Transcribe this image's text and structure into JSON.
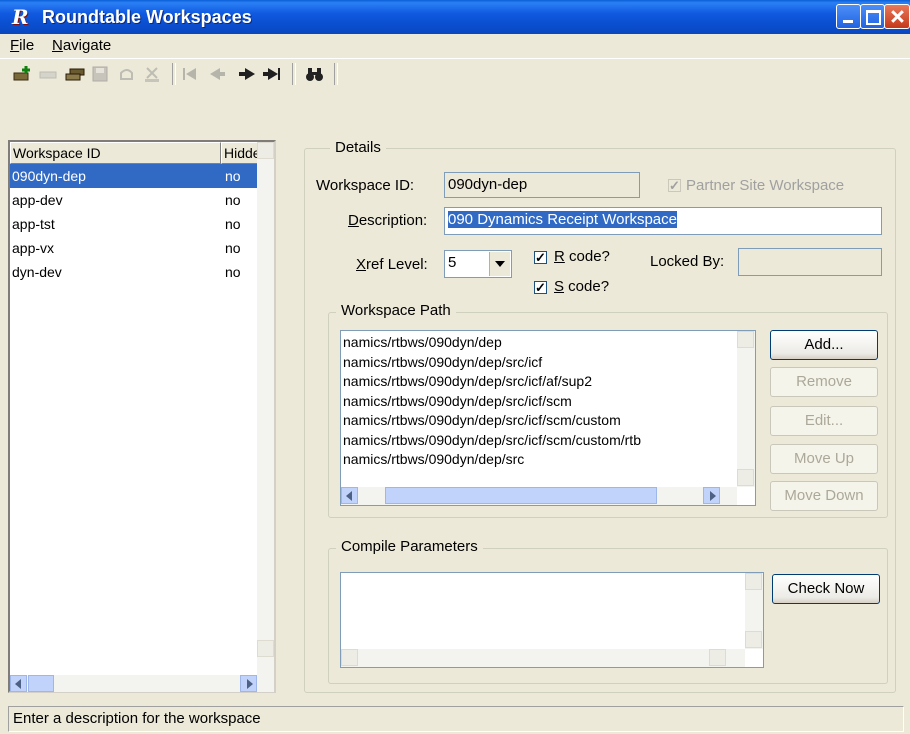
{
  "window": {
    "title": "Roundtable Workspaces",
    "app_icon": "R"
  },
  "menu": {
    "file": "File",
    "navigate": "Navigate"
  },
  "toolbar": {
    "icons": [
      "add-icon",
      "rename-icon",
      "copy-icon",
      "save-icon",
      "undo-icon",
      "delete-icon",
      "first-icon",
      "prev-icon",
      "next-icon",
      "last-icon",
      "binoculars-icon"
    ]
  },
  "list": {
    "columns": [
      "Workspace ID",
      "Hidde"
    ],
    "rows": [
      {
        "id": "090dyn-dep",
        "hidden": "no"
      },
      {
        "id": "app-dev",
        "hidden": "no"
      },
      {
        "id": "app-tst",
        "hidden": "no"
      },
      {
        "id": "app-vx",
        "hidden": "no"
      },
      {
        "id": "dyn-dev",
        "hidden": "no"
      }
    ]
  },
  "details": {
    "legend": "Details",
    "workspace_id_label": "Workspace ID:",
    "workspace_id_value": "090dyn-dep",
    "partner_label": "Partner Site Workspace",
    "description_label": "Description:",
    "description_value": "090 Dynamics Receipt Workspace",
    "xref_label": "Xref Level:",
    "xref_value": "5",
    "rcode_label": "R code?",
    "scode_label": "S code?",
    "locked_by_label": "Locked By:",
    "locked_by_value": ""
  },
  "workspace_path": {
    "legend": "Workspace Path",
    "paths": [
      "namics/rtbws/090dyn/dep",
      "namics/rtbws/090dyn/dep/src/icf",
      "namics/rtbws/090dyn/dep/src/icf/af/sup2",
      "namics/rtbws/090dyn/dep/src/icf/scm",
      "namics/rtbws/090dyn/dep/src/icf/scm/custom",
      "namics/rtbws/090dyn/dep/src/icf/scm/custom/rtb",
      "namics/rtbws/090dyn/dep/src"
    ],
    "buttons": {
      "add": "Add...",
      "remove": "Remove",
      "edit": "Edit...",
      "move_up": "Move Up",
      "move_down": "Move Down"
    }
  },
  "compile": {
    "legend": "Compile Parameters",
    "check_now": "Check Now"
  },
  "status": "Enter a description for the workspace",
  "colors": {
    "title_blue": "#0b4fd0",
    "selection": "#316ac5",
    "window_bg": "#ece9d8"
  }
}
